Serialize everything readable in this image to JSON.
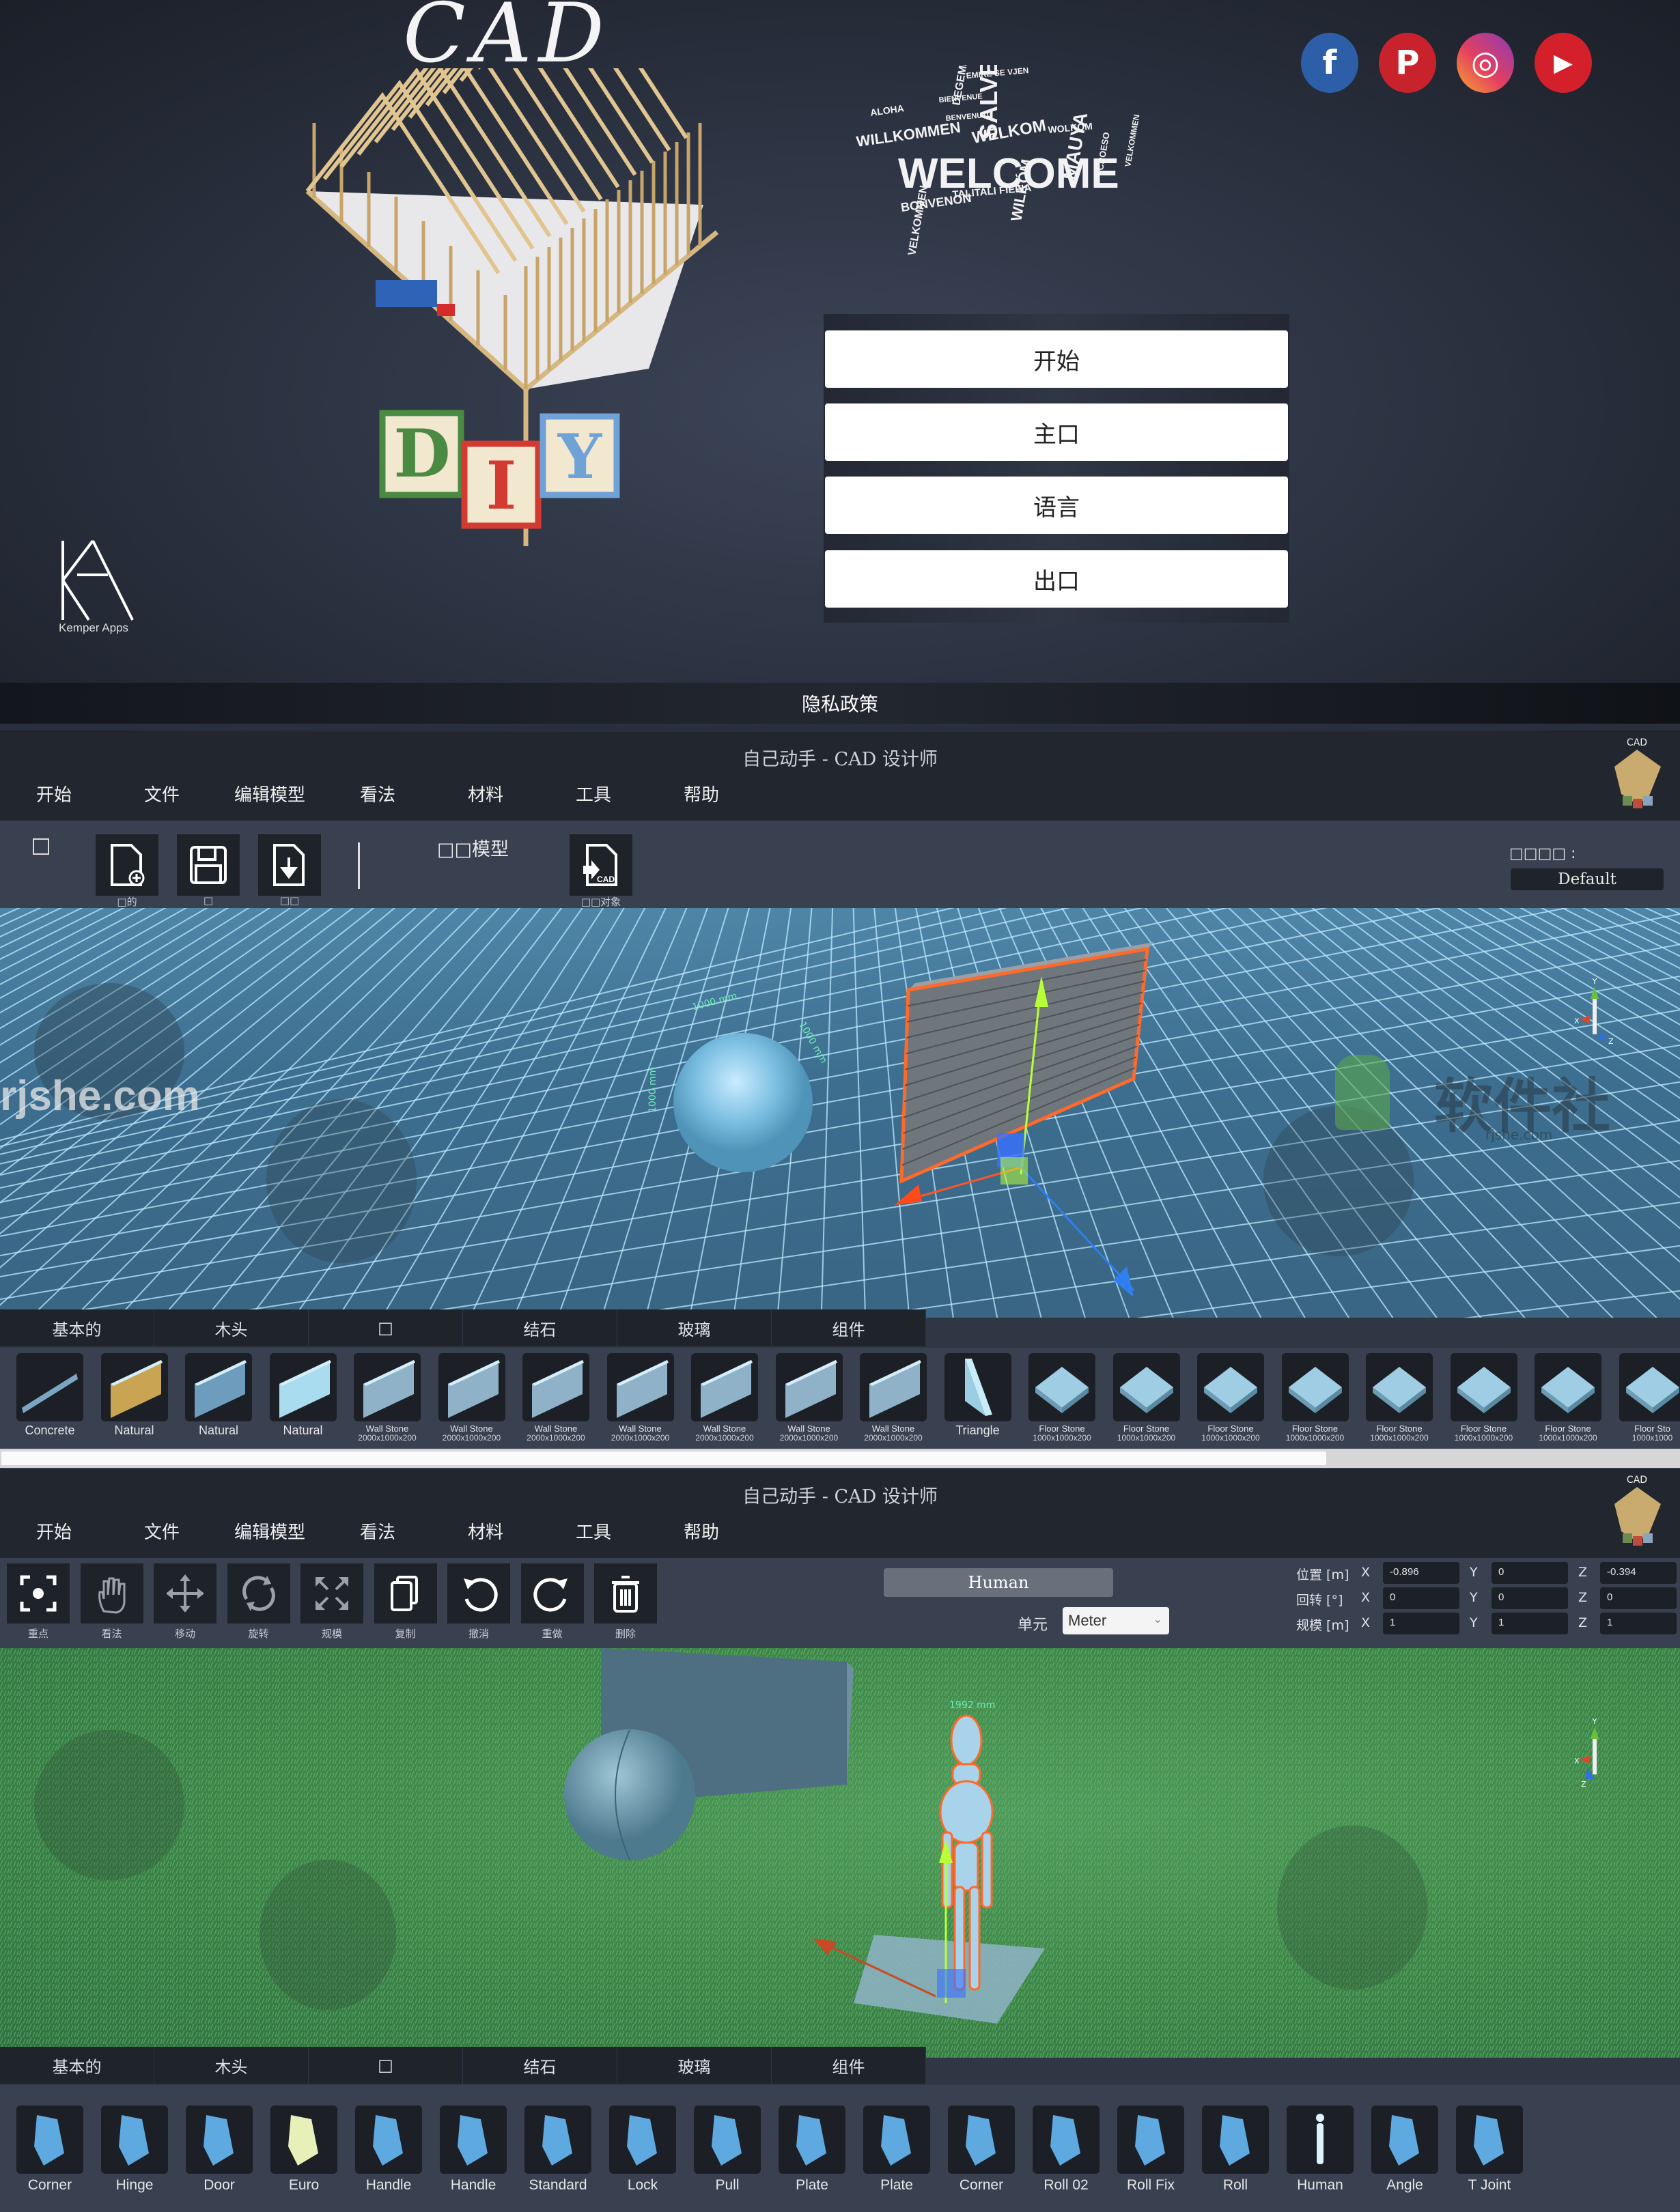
{
  "splash": {
    "cad_title": "CAD",
    "diy_letters": [
      "D",
      "I",
      "Y"
    ],
    "brand": "Kemper Apps",
    "brand_mark": "KA",
    "welcome_cloud": [
      "WELCOME",
      "SALVE",
      "WELKOM",
      "WILLKOMMEN",
      "ALOHA",
      "MAUYA",
      "BONVENON",
      "WILKÓM",
      "VELKOMMEN",
      "DEGEMER MAT",
      "TALITALI FIEFIA",
      "BIENVENUE",
      "BENVENUTO",
      "EMIRË SE VJEN",
      "CROESO",
      "WOLKOM",
      "VELKOMMEN"
    ],
    "social": [
      {
        "name": "facebook",
        "glyph": "f",
        "color": "#2d5fa8"
      },
      {
        "name": "pinterest",
        "glyph": "P",
        "color": "#c8232c"
      },
      {
        "name": "instagram",
        "glyph": "◎",
        "color": "#d6336c"
      },
      {
        "name": "youtube",
        "glyph": "▶",
        "color": "#d4202a"
      }
    ],
    "menu": [
      "开始",
      "主口",
      "语言",
      "出口"
    ],
    "privacy": "隐私政策"
  },
  "editor1": {
    "title": "自己动手 - CAD 设计师",
    "menu": [
      "开始",
      "文件",
      "编辑模型",
      "看法",
      "材料",
      "工具",
      "帮助"
    ],
    "toolbar": {
      "checkbox_label": "□",
      "buttons": [
        {
          "icon": "new-file-icon",
          "label": "□的"
        },
        {
          "icon": "save-icon",
          "label": "□"
        },
        {
          "icon": "import-icon",
          "label": "□□"
        }
      ],
      "model_label": "□□模型",
      "cad_button": {
        "icon": "cad-import-icon",
        "label": "□□对象"
      },
      "preset_label": "□□□□ :",
      "preset_value": "Default"
    },
    "viewport": {
      "dimension_labels": [
        "1000 mm",
        "1000 mm",
        "1000 mm"
      ],
      "watermark_left": "rjshe.com",
      "watermark_right": "软件社",
      "watermark_right_sub": "rjshe.com",
      "axis_labels": [
        "Y",
        "X",
        "Z"
      ]
    },
    "tabs": [
      "基本的",
      "木头",
      "□",
      "结石",
      "玻璃",
      "组件"
    ],
    "items": [
      {
        "label": "Concrete",
        "sub": "",
        "small": false,
        "kind": "slab"
      },
      {
        "label": "Natural",
        "sub": "",
        "small": false,
        "kind": "wood"
      },
      {
        "label": "Natural",
        "sub": "",
        "small": false,
        "kind": "blue"
      },
      {
        "label": "Natural",
        "sub": "",
        "small": false,
        "kind": "light"
      },
      {
        "label": "Wall Stone",
        "sub": "2000x1000x200",
        "small": true,
        "kind": "wall"
      },
      {
        "label": "Wall Stone",
        "sub": "2000x1000x200",
        "small": true,
        "kind": "wall"
      },
      {
        "label": "Wall Stone",
        "sub": "2000x1000x200",
        "small": true,
        "kind": "wall"
      },
      {
        "label": "Wall Stone",
        "sub": "2000x1000x200",
        "small": true,
        "kind": "wall"
      },
      {
        "label": "Wall Stone",
        "sub": "2000x1000x200",
        "small": true,
        "kind": "wall"
      },
      {
        "label": "Wall Stone",
        "sub": "2000x1000x200",
        "small": true,
        "kind": "wall"
      },
      {
        "label": "Wall Stone",
        "sub": "2000x1000x200",
        "small": true,
        "kind": "wall"
      },
      {
        "label": "Triangle",
        "sub": "",
        "small": false,
        "kind": "tri"
      },
      {
        "label": "Floor Stone",
        "sub": "1000x1000x200",
        "small": true,
        "kind": "floor"
      },
      {
        "label": "Floor Stone",
        "sub": "1000x1000x200",
        "small": true,
        "kind": "floor"
      },
      {
        "label": "Floor Stone",
        "sub": "1000x1000x200",
        "small": true,
        "kind": "floor"
      },
      {
        "label": "Floor Stone",
        "sub": "1000x1000x200",
        "small": true,
        "kind": "floor"
      },
      {
        "label": "Floor Stone",
        "sub": "1000x1000x200",
        "small": true,
        "kind": "floor"
      },
      {
        "label": "Floor Stone",
        "sub": "1000x1000x200",
        "small": true,
        "kind": "floor"
      },
      {
        "label": "Floor Stone",
        "sub": "1000x1000x200",
        "small": true,
        "kind": "floor"
      },
      {
        "label": "Floor Sto",
        "sub": "1000x1000",
        "small": true,
        "kind": "floor"
      }
    ],
    "scroll_position": 0.79
  },
  "editor2": {
    "title": "自己动手 - CAD 设计师",
    "menu": [
      "开始",
      "文件",
      "编辑模型",
      "看法",
      "材料",
      "工具",
      "帮助"
    ],
    "tools": [
      {
        "icon": "focus-icon",
        "label": "重点"
      },
      {
        "icon": "hand-icon",
        "label": "看法"
      },
      {
        "icon": "move-icon",
        "label": "移动"
      },
      {
        "icon": "rotate-icon",
        "label": "旋转"
      },
      {
        "icon": "scale-icon",
        "label": "规模"
      },
      {
        "icon": "copy-icon",
        "label": "复制"
      },
      {
        "icon": "undo-icon",
        "label": "撤消"
      },
      {
        "icon": "redo-icon",
        "label": "重做"
      },
      {
        "icon": "trash-icon",
        "label": "删除"
      }
    ],
    "selected_object": "Human",
    "unit_label": "单元",
    "unit_value": "Meter",
    "transform": {
      "position_label": "位置 [m]",
      "rotation_label": "回转  [°]",
      "scale_label": "规模 [m]",
      "axes": [
        "X",
        "Y",
        "Z"
      ],
      "position": [
        "-0.896",
        "0",
        "-0.394"
      ],
      "rotation": [
        "0",
        "0",
        "0"
      ],
      "scale": [
        "1",
        "1",
        "1"
      ]
    },
    "viewport": {
      "dimension_label": "1992 mm",
      "axis_labels": [
        "Y",
        "X",
        "Z"
      ]
    },
    "tabs": [
      "基本的",
      "木头",
      "□",
      "结石",
      "玻璃",
      "组件"
    ],
    "items": [
      {
        "label": "Corner"
      },
      {
        "label": "Hinge"
      },
      {
        "label": "Door"
      },
      {
        "label": "Euro"
      },
      {
        "label": "Handle"
      },
      {
        "label": "Handle"
      },
      {
        "label": "Standard"
      },
      {
        "label": "Lock"
      },
      {
        "label": "Pull"
      },
      {
        "label": "Plate"
      },
      {
        "label": "Plate"
      },
      {
        "label": "Corner"
      },
      {
        "label": "Roll 02"
      },
      {
        "label": "Roll Fix"
      },
      {
        "label": "Roll"
      },
      {
        "label": "Human"
      },
      {
        "label": "Angle"
      },
      {
        "label": "T Joint"
      }
    ]
  }
}
